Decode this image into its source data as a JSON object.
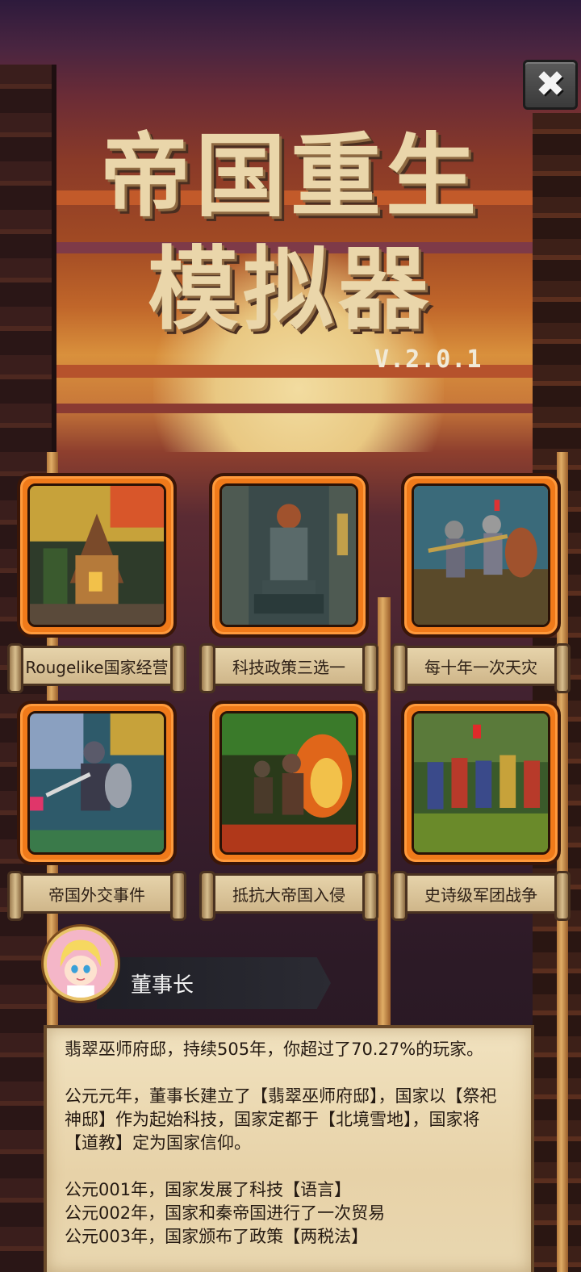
{
  "window": {
    "close_icon": "close-icon"
  },
  "title": {
    "line1": "帝国重生",
    "line2": "模拟器",
    "version": "V.2.0.1"
  },
  "features": [
    {
      "label": "Rougelike国家经营",
      "icon": "village-art"
    },
    {
      "label": "科技政策三选一",
      "icon": "statue-art"
    },
    {
      "label": "每十年一次天灾",
      "icon": "knights-art"
    },
    {
      "label": "帝国外交事件",
      "icon": "warrior-art"
    },
    {
      "label": "抵抗大帝国入侵",
      "icon": "fire-battle-art"
    },
    {
      "label": "史诗级军团战争",
      "icon": "legion-art"
    }
  ],
  "user": {
    "name": "董事长",
    "avatar_icon": "avatar-icon"
  },
  "log": {
    "summary": "翡翠巫师府邸，持续505年，你超过了70.27%的玩家。",
    "intro": "公元元年，董事长建立了【翡翠巫师府邸】，国家以【祭祀神邸】作为起始科技，国家定都于【北境雪地】，国家将【道教】定为国家信仰。",
    "entries": [
      "公元001年，国家发展了科技【语言】",
      "公元002年，国家和秦帝国进行了一次贸易",
      "公元003年，国家颁布了政策【两税法】"
    ]
  },
  "colors": {
    "card_frame": "#f07a1a",
    "title_text": "#ead6aa",
    "parchment": "#e7d2a8"
  }
}
